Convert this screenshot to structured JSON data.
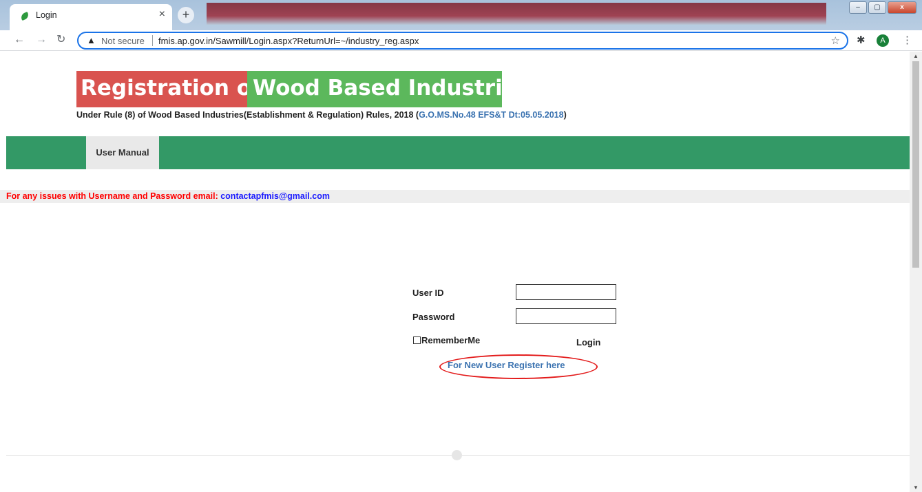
{
  "browser": {
    "tab_title": "Login",
    "tab_close": "×",
    "new_tab": "+",
    "window_controls": [
      "–",
      "▢",
      "x"
    ],
    "security_label": "Not secure",
    "url": "fmis.ap.gov.in/Sawmill/Login.aspx?ReturnUrl=~/industry_reg.aspx",
    "profile_initial": "A",
    "icons": [
      "back-icon",
      "forward-icon",
      "reload-icon",
      "warning-icon",
      "star-icon",
      "puzzle-icon",
      "kebab-menu-icon"
    ]
  },
  "header": {
    "title_part1": "Registration of",
    "title_part2": "Wood Based Industries",
    "subtitle_prefix": "Under Rule (8) of Wood Based Industries(Establishment & Regulation) Rules, 2018 (",
    "subtitle_link": "G.O.MS.No.48 EFS&T Dt:05.05.2018",
    "subtitle_suffix": ")"
  },
  "nav": {
    "items": [
      {
        "label": "User Manual"
      }
    ]
  },
  "notice": {
    "text": "For any issues with Username and Password email: ",
    "email": "contactapfmis@gmail.com"
  },
  "login_form": {
    "user_id_label": "User ID",
    "user_id_value": "",
    "password_label": "Password",
    "password_value": "",
    "remember_label": "RememberMe",
    "remember_checked": false,
    "login_label": "Login",
    "register_link": "For New User Register here"
  },
  "colors": {
    "title_red": "#d9534f",
    "title_green": "#5cb85c",
    "nav_green": "#339966",
    "notice_red": "#ff0000",
    "link_blue": "#3a72b0",
    "highlight": "#e31b1b"
  }
}
